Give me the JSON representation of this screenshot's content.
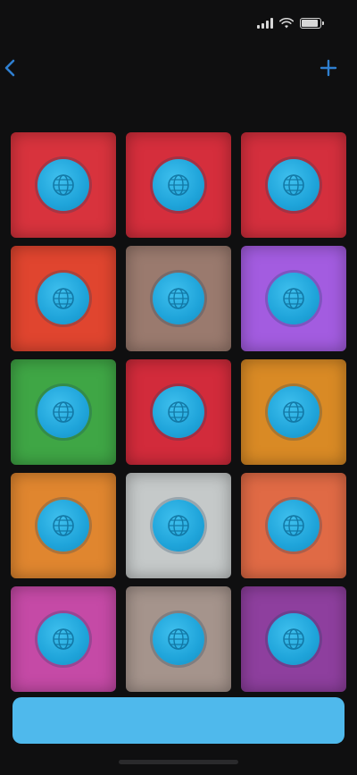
{
  "status_bar": {
    "time": "",
    "battery_level": 0.9
  },
  "nav": {
    "back_label": "",
    "title": "",
    "action_icon": "plus-icon"
  },
  "section": {
    "header": ""
  },
  "tiles": [
    {
      "color": "#d8333d",
      "icon": "globe-icon"
    },
    {
      "color": "#d52e3c",
      "icon": "globe-icon"
    },
    {
      "color": "#d42f3d",
      "icon": "globe-icon"
    },
    {
      "color": "#e0452f",
      "icon": "globe-icon"
    },
    {
      "color": "#9a7a6e",
      "icon": "globe-icon"
    },
    {
      "color": "#a35ce0",
      "icon": "globe-icon"
    },
    {
      "color": "#3fa645",
      "icon": "globe-icon"
    },
    {
      "color": "#d22b3b",
      "icon": "globe-icon"
    },
    {
      "color": "#d98a25",
      "icon": "globe-icon"
    },
    {
      "color": "#e0862f",
      "icon": "globe-icon"
    },
    {
      "color": "#c5c9c9",
      "icon": "globe-icon"
    },
    {
      "color": "#e06a45",
      "icon": "globe-icon"
    },
    {
      "color": "#c54aa6",
      "icon": "globe-icon"
    },
    {
      "color": "#a5948c",
      "icon": "globe-icon"
    },
    {
      "color": "#8e3f9e",
      "icon": "globe-icon"
    }
  ],
  "primary_button": {
    "label": ""
  },
  "colors": {
    "accent": "#4fb9ec",
    "badge": "#1fa4da",
    "background": "#0f0f10"
  }
}
